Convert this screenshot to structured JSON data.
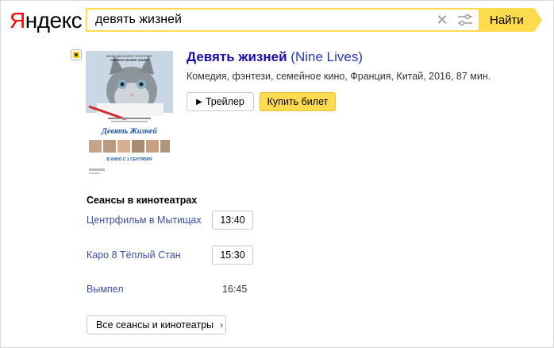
{
  "header": {
    "logo_first": "Я",
    "logo_rest": "ндекс",
    "search_value": "девять жизней",
    "find_label": "Найти"
  },
  "film": {
    "title": "Девять жизней",
    "original_title": "(Nine Lives)",
    "meta": "Комедия, фэнтези, семейное кино, Франция, Китай, 2016, 87 мин.",
    "trailer_label": "Трейлер",
    "buy_label": "Купить билет",
    "poster": {
      "actors_line": "КЕВИН   ДЖЕННИФЕР   КРИСТОФЕР",
      "actors_line2": "СПЕЙСИ   ГАРНЕР   УОКЕН",
      "poster_title": "Девять Жизней",
      "release": "В КИНО С 1 СЕНТЯБРЯ"
    }
  },
  "sessions": {
    "title": "Сеансы в кинотеатрах",
    "items": [
      {
        "cinema": "Центрфильм в Мытищах",
        "time": "13:40"
      },
      {
        "cinema": "Каро 8 Тёплый Стан",
        "time": "15:30"
      },
      {
        "cinema": "Вымпел",
        "time": "16:45"
      }
    ],
    "all_label": "Все сеансы и кинотеатры"
  },
  "colors": {
    "accent_yellow": "#ffdb4d",
    "link_blue": "#1a0dab",
    "logo_red": "#ff0000"
  }
}
